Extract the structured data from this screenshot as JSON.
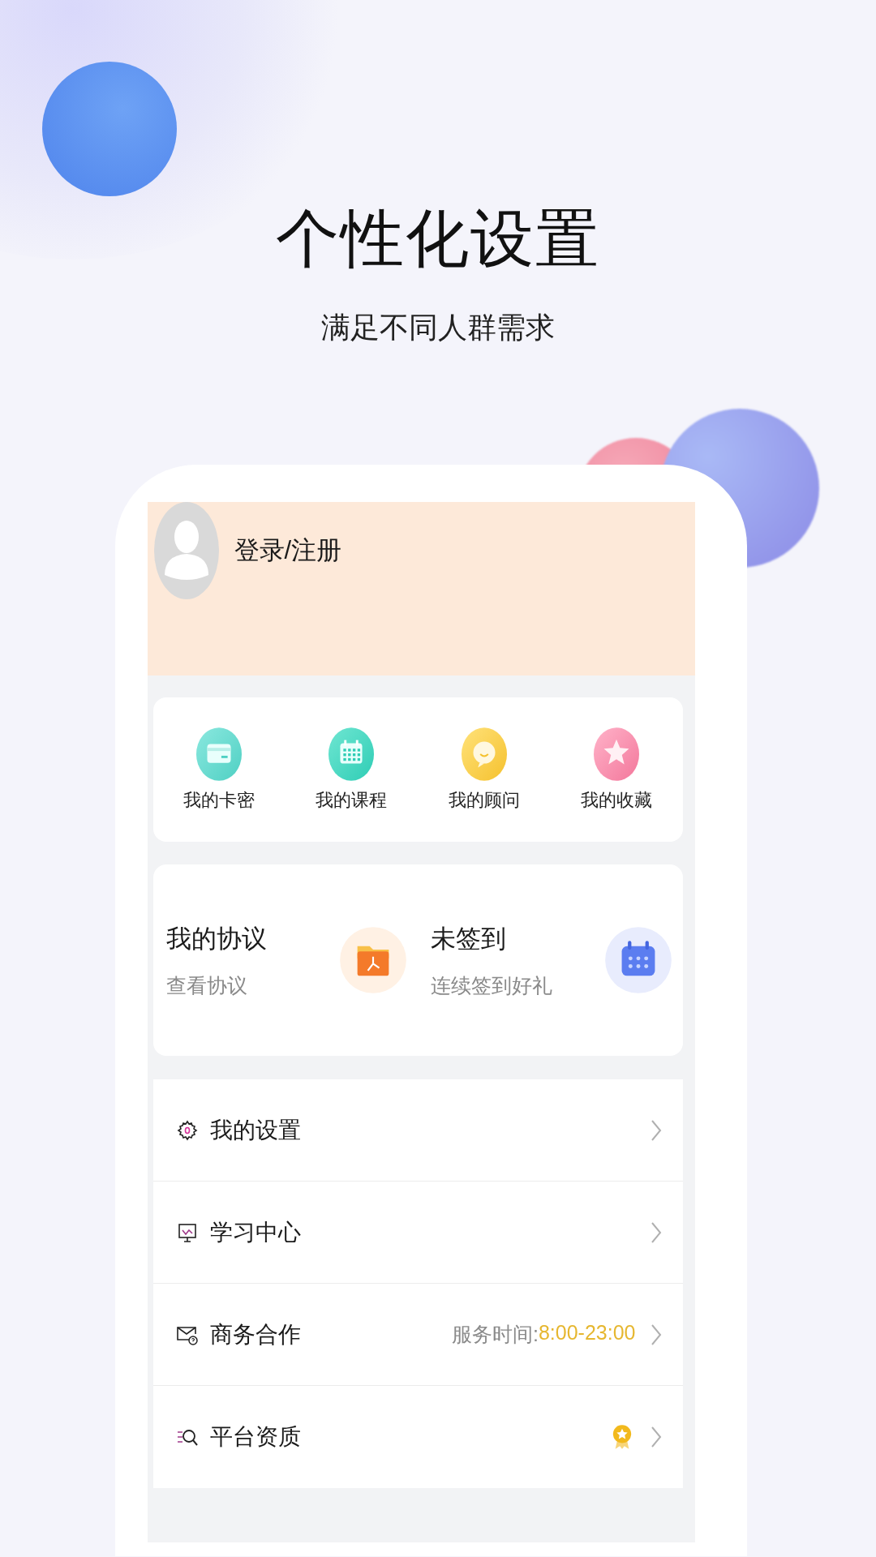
{
  "headline": "个性化设置",
  "subheadline": "满足不同人群需求",
  "profile": {
    "login_label": "登录/注册"
  },
  "shortcuts": [
    {
      "label": "我的卡密",
      "kind": "card"
    },
    {
      "label": "我的课程",
      "kind": "calendar"
    },
    {
      "label": "我的顾问",
      "kind": "chat"
    },
    {
      "label": "我的收藏",
      "kind": "star"
    }
  ],
  "promo_cards": [
    {
      "title": "我的协议",
      "subtitle": "查看协议",
      "kind": "folder"
    },
    {
      "title": "未签到",
      "subtitle": "连续签到好礼",
      "kind": "calendar"
    }
  ],
  "menu": [
    {
      "label": "我的设置",
      "kind": "settings"
    },
    {
      "label": "学习中心",
      "kind": "board"
    },
    {
      "label": "商务合作",
      "kind": "mail",
      "note_label": "服务时间:",
      "note_value": "8:00-23:00"
    },
    {
      "label": "平台资质",
      "kind": "qualification"
    }
  ]
}
